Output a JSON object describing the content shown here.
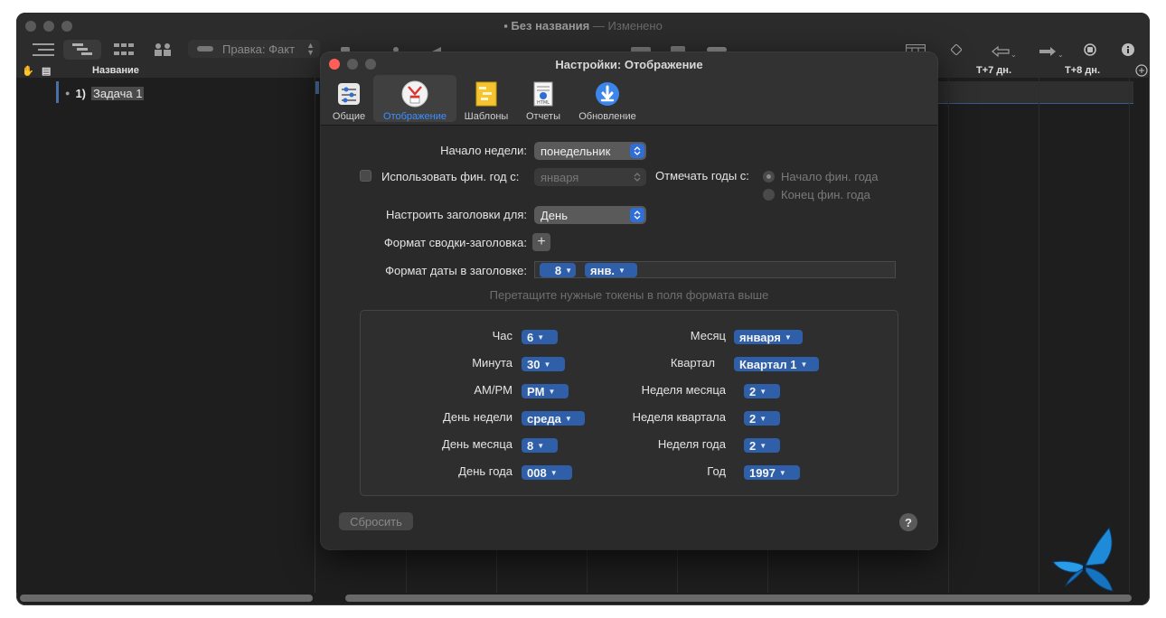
{
  "window": {
    "title": "Без названия",
    "separator": "—",
    "status": "Изменено",
    "popup_label": "Правка: Факт",
    "outline_header": "Название",
    "gantt_headers": [
      "T+7 дн.",
      "T+8 дн."
    ],
    "task": {
      "number": "1)",
      "name": "Задача 1"
    }
  },
  "dialog": {
    "title": "Настройки: Отображение",
    "tabs": [
      {
        "label": "Общие",
        "icon": "general-settings-icon"
      },
      {
        "label": "Отображение",
        "icon": "display-clock-icon",
        "selected": true
      },
      {
        "label": "Шаблоны",
        "icon": "templates-icon"
      },
      {
        "label": "Отчеты",
        "icon": "reports-html-icon"
      },
      {
        "label": "Обновление",
        "icon": "update-download-icon"
      }
    ],
    "week_start": {
      "label": "Начало недели:",
      "value": "понедельник"
    },
    "fiscal": {
      "checkbox_label": "Использовать фин. год с:",
      "value": "января",
      "checked": false
    },
    "mark_years": {
      "label": "Отмечать годы с:",
      "options": [
        "Начало фин. года",
        "Конец фин. года"
      ],
      "selected": 0
    },
    "headers": {
      "label": "Настроить заголовки для:",
      "value": "День"
    },
    "summary_format": {
      "label": "Формат сводки-заголовка:",
      "add": "+"
    },
    "date_format": {
      "label": "Формат даты в заголовке:",
      "tokens": [
        "8",
        "янв."
      ]
    },
    "hint": "Перетащите нужные токены в поля формата выше",
    "tokens_left": [
      {
        "label": "Час",
        "value": "6"
      },
      {
        "label": "Минута",
        "value": "30"
      },
      {
        "label": "AM/PM",
        "value": "PM"
      },
      {
        "label": "День недели",
        "value": "среда"
      },
      {
        "label": "День месяца",
        "value": "8"
      },
      {
        "label": "День года",
        "value": "008"
      }
    ],
    "tokens_right": [
      {
        "label": "Месяц",
        "value": "января"
      },
      {
        "label": "Квартал",
        "value": "Квартал 1"
      },
      {
        "label": "Неделя месяца",
        "value": "2"
      },
      {
        "label": "Неделя квартала",
        "value": "2"
      },
      {
        "label": "Неделя года",
        "value": "2"
      },
      {
        "label": "Год",
        "value": "1997"
      }
    ],
    "reset": "Сбросить",
    "help": "?"
  },
  "colors": {
    "accent": "#2f6ed6",
    "token": "#2f5fa8",
    "close": "#ff5f57"
  }
}
